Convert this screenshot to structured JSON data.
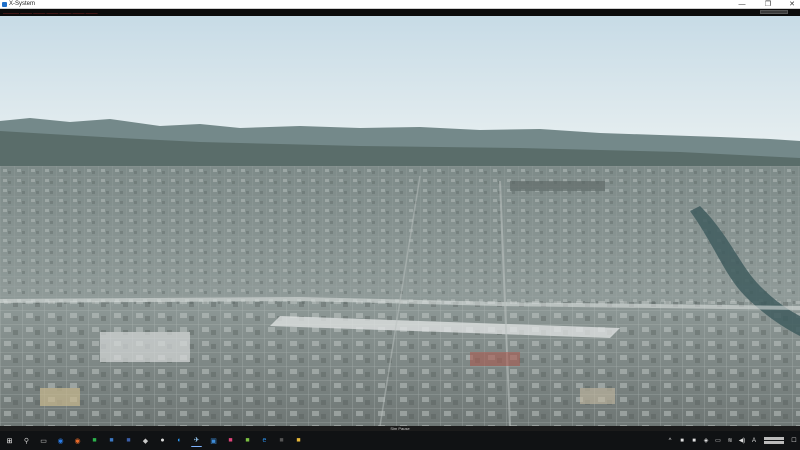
{
  "window": {
    "title": "X-System",
    "minimize_glyph": "—",
    "maximize_glyph": "❐",
    "close_glyph": "✕"
  },
  "hud": {
    "status_text": "———— ——— ——— ——— ——— ——— ———"
  },
  "scene": {
    "description_colors": {
      "sky_top": "#cfe0ea",
      "sky_bottom": "#e7eef0",
      "mountains": "#5d7372",
      "city": "#8c9896",
      "river": "#3d5b5e"
    }
  },
  "bottom_message": "Sim Pause",
  "taskbar": {
    "icons": [
      {
        "name": "windows-start-icon",
        "glyph": "⊞",
        "color": "#ffffff"
      },
      {
        "name": "search-icon",
        "glyph": "⚲",
        "color": "#cfcfcf"
      },
      {
        "name": "task-view-icon",
        "glyph": "▭",
        "color": "#cfcfcf"
      },
      {
        "name": "browser-icon",
        "glyph": "◉",
        "color": "#2a7be4"
      },
      {
        "name": "firefox-icon",
        "glyph": "◉",
        "color": "#e86a2a"
      },
      {
        "name": "app-icon-green",
        "glyph": "■",
        "color": "#2bb24c"
      },
      {
        "name": "app-icon-blue",
        "glyph": "■",
        "color": "#3b78c4"
      },
      {
        "name": "app-icon-navy",
        "glyph": "■",
        "color": "#3b5ea8"
      },
      {
        "name": "app-icon-gray",
        "glyph": "◆",
        "color": "#c9c9c9"
      },
      {
        "name": "app-icon-light",
        "glyph": "●",
        "color": "#dcdcdc"
      },
      {
        "name": "edge-icon",
        "glyph": "◐",
        "color": "#2fa0ff"
      },
      {
        "name": "xsystem-icon",
        "glyph": "✈",
        "color": "#9fd3ff"
      },
      {
        "name": "photos-icon",
        "glyph": "▣",
        "color": "#3d8cd8"
      },
      {
        "name": "app-icon-pink",
        "glyph": "■",
        "color": "#e0447a"
      },
      {
        "name": "app-icon-lime",
        "glyph": "■",
        "color": "#7cc142"
      },
      {
        "name": "ie-icon",
        "glyph": "e",
        "color": "#2a8ae0"
      },
      {
        "name": "app-icon-dark",
        "glyph": "■",
        "color": "#555555"
      },
      {
        "name": "folder-icon",
        "glyph": "■",
        "color": "#e8b83a"
      }
    ]
  },
  "tray": {
    "icons": [
      {
        "name": "chevron-up-icon",
        "glyph": "^"
      },
      {
        "name": "app-tray-green-icon",
        "glyph": "■"
      },
      {
        "name": "app-tray-blue-icon",
        "glyph": "■"
      },
      {
        "name": "shield-icon",
        "glyph": "◈"
      },
      {
        "name": "battery-icon",
        "glyph": "▭"
      },
      {
        "name": "network-icon",
        "glyph": "≋"
      },
      {
        "name": "volume-icon",
        "glyph": "◀)"
      },
      {
        "name": "ime-icon",
        "glyph": "A"
      }
    ],
    "notification_glyph": "☐"
  }
}
